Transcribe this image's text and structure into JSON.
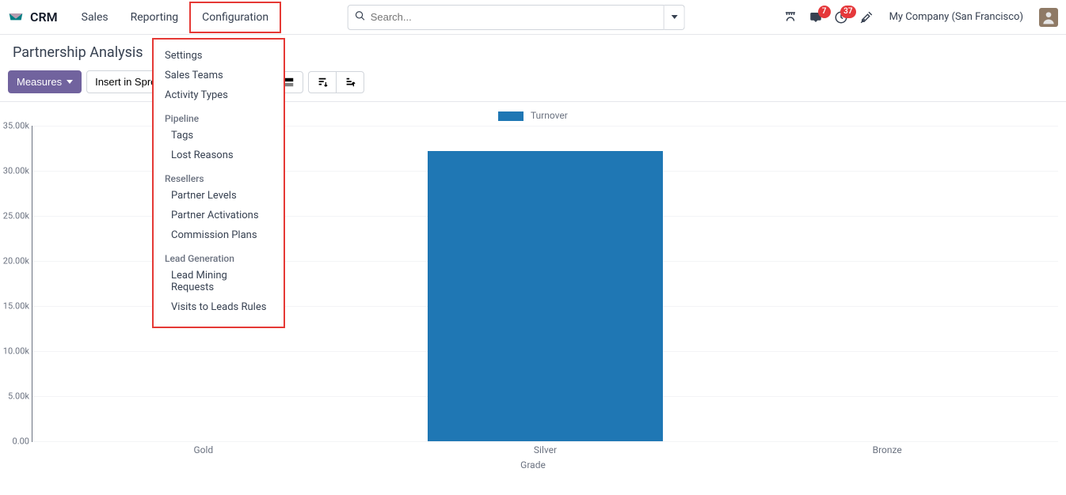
{
  "brand": "CRM",
  "nav": [
    "Sales",
    "Reporting",
    "Configuration"
  ],
  "active_nav_index": 2,
  "badges": {
    "messages": "7",
    "activities": "37"
  },
  "company": "My Company (San Francisco)",
  "page_title": "Partnership Analysis",
  "toolbar": {
    "measures": "Measures",
    "insert": "Insert in Spread"
  },
  "search": {
    "placeholder": "Search..."
  },
  "dropdown": {
    "top": [
      "Settings",
      "Sales Teams",
      "Activity Types"
    ],
    "sections": [
      {
        "label": "Pipeline",
        "items": [
          "Tags",
          "Lost Reasons"
        ]
      },
      {
        "label": "Resellers",
        "items": [
          "Partner Levels",
          "Partner Activations",
          "Commission Plans"
        ]
      },
      {
        "label": "Lead Generation",
        "items": [
          "Lead Mining Requests",
          "Visits to Leads Rules"
        ]
      }
    ]
  },
  "chart_data": {
    "type": "bar",
    "title": "",
    "xlabel": "Grade",
    "ylabel": "",
    "ylim": [
      0,
      35000
    ],
    "yticks": [
      0,
      5000,
      10000,
      15000,
      20000,
      25000,
      30000,
      35000
    ],
    "ytick_labels": [
      "0.00",
      "5.00k",
      "10.00k",
      "15.00k",
      "20.00k",
      "25.00k",
      "30.00k",
      "35.00k"
    ],
    "categories": [
      "Gold",
      "Silver",
      "Bronze"
    ],
    "series": [
      {
        "name": "Turnover",
        "color": "#1f77b4",
        "values": [
          0,
          32200,
          0
        ]
      }
    ]
  }
}
